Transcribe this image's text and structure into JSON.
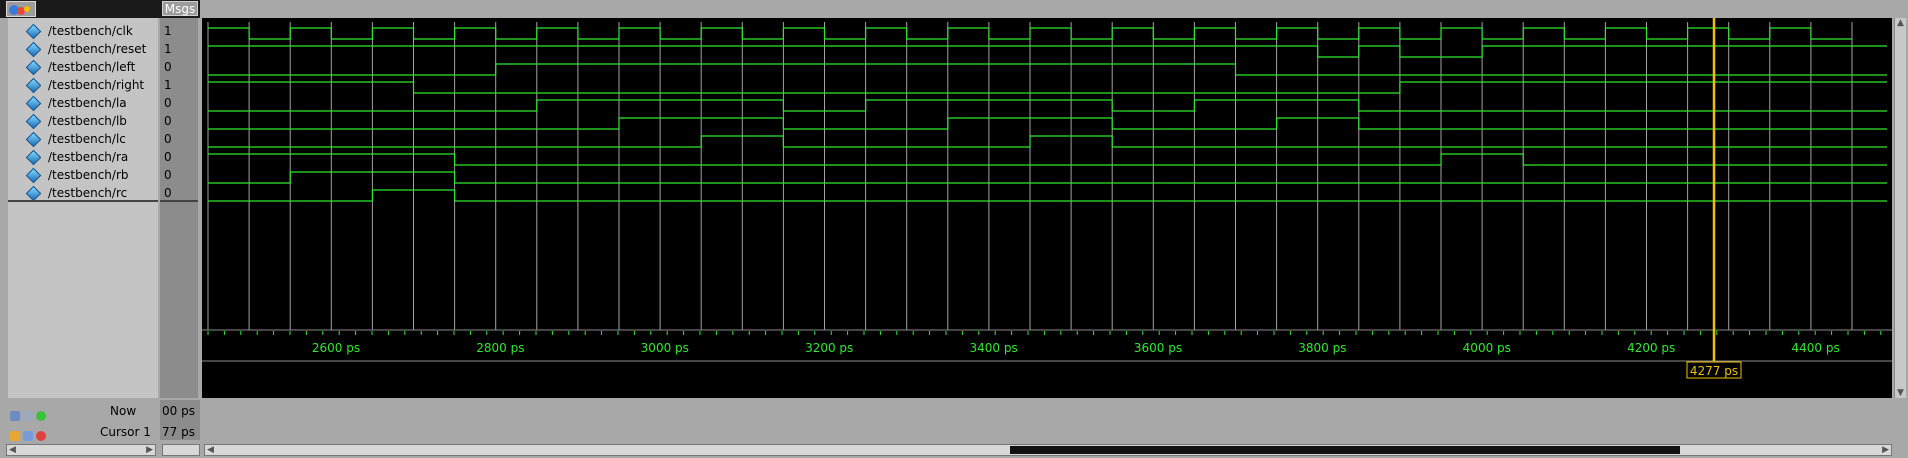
{
  "header": {
    "msgs_label": "Msgs"
  },
  "signals": [
    {
      "name": "/testbench/clk",
      "value": "1"
    },
    {
      "name": "/testbench/reset",
      "value": "1"
    },
    {
      "name": "/testbench/left",
      "value": "0"
    },
    {
      "name": "/testbench/right",
      "value": "1"
    },
    {
      "name": "/testbench/la",
      "value": "0"
    },
    {
      "name": "/testbench/lb",
      "value": "0"
    },
    {
      "name": "/testbench/lc",
      "value": "0"
    },
    {
      "name": "/testbench/ra",
      "value": "0"
    },
    {
      "name": "/testbench/rb",
      "value": "0"
    },
    {
      "name": "/testbench/rc",
      "value": "0"
    }
  ],
  "status": {
    "now_label": "Now",
    "now_value": "00 ps",
    "cursor_label": "Cursor 1",
    "cursor_value": "77 ps"
  },
  "timeline": {
    "tick_labels": [
      "2600 ps",
      "2800 ps",
      "3000 ps",
      "3200 ps",
      "3400 ps",
      "3600 ps",
      "3800 ps",
      "4000 ps",
      "4200 ps",
      "4400 ps"
    ],
    "cursor_label": "4277 ps"
  },
  "colors": {
    "wave": "#2ee82e",
    "cursor": "#f0c000",
    "grid": "#ffffff",
    "background": "#000000"
  }
}
